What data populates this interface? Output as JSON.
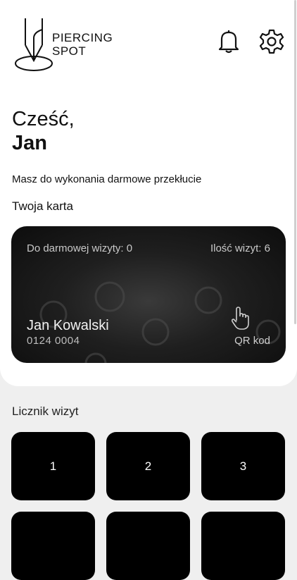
{
  "app": {
    "brand_line1": "PIERCING",
    "brand_line2": "SPOT"
  },
  "header": {
    "icons": [
      "bell-icon",
      "gear-icon"
    ]
  },
  "greeting": {
    "hello": "Cześć,",
    "user_name": "Jan"
  },
  "promo_text": "Masz do wykonania darmowe przekłucie",
  "card_section_label": "Twoja karta",
  "card": {
    "free_visit_label": "Do darmowej wizyty: 0",
    "visits_label": "Ilość wizyt: 6",
    "holder_name": "Jan Kowalski",
    "card_number": "0124 0004",
    "qr_label": "QR kod",
    "qr_icon": "tap-hand-icon"
  },
  "counter": {
    "title": "Licznik wizyt",
    "tiles": [
      "1",
      "2",
      "3",
      "",
      "",
      ""
    ]
  },
  "colors": {
    "background": "#efefef",
    "panel": "#ffffff",
    "card": "#1a1a1a",
    "tile": "#000000"
  }
}
